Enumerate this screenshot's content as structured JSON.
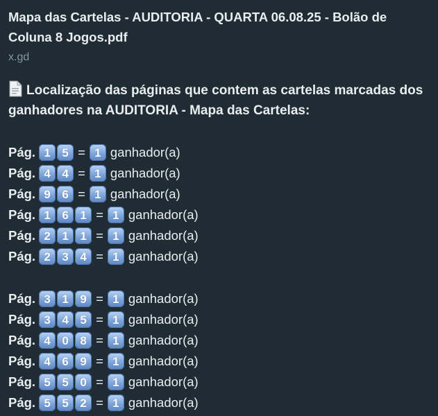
{
  "link_preview": {
    "title": "Mapa das Cartelas - AUDITORIA - QUARTA 06.08.25 - Bolão de Coluna 8 Jogos.pdf",
    "domain": "x.gd"
  },
  "message": {
    "heading": "Localização das páginas que contem as cartelas marcadas dos ganhadores na AUDITORIA - Mapa das Cartelas:",
    "heading_icon": "page-facing-up-icon",
    "page_prefix": "Pág.",
    "equals": "=",
    "winner_label": "ganhador(a)",
    "groups": [
      {
        "rows": [
          {
            "page": "15",
            "count": "1"
          },
          {
            "page": "44",
            "count": "1"
          },
          {
            "page": "96",
            "count": "1"
          },
          {
            "page": "161",
            "count": "1"
          },
          {
            "page": "211",
            "count": "1"
          },
          {
            "page": "234",
            "count": "1"
          }
        ]
      },
      {
        "rows": [
          {
            "page": "319",
            "count": "1"
          },
          {
            "page": "345",
            "count": "1"
          },
          {
            "page": "408",
            "count": "1"
          },
          {
            "page": "469",
            "count": "1"
          },
          {
            "page": "550",
            "count": "1"
          },
          {
            "page": "552",
            "count": "1"
          }
        ]
      }
    ]
  }
}
